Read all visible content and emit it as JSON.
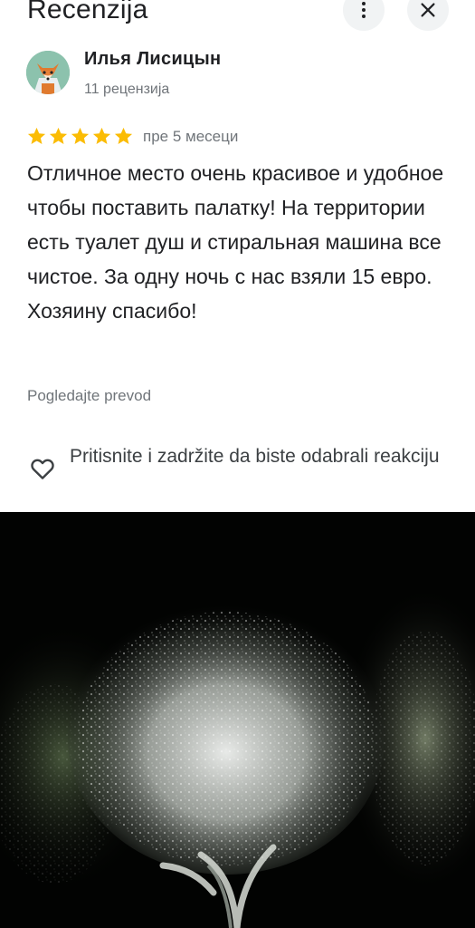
{
  "header": {
    "title": "Recenzija",
    "more_icon": "more-vert-icon",
    "close_icon": "close-icon"
  },
  "reviewer": {
    "name": "Илья Лисицын",
    "meta": "11 рецензија",
    "avatar_icon": "fox-avatar"
  },
  "review": {
    "rating": 5,
    "rating_max": 5,
    "star_color": "#fbbc04",
    "date": "пре 5 месеци",
    "text": "Отличное место очень красивое и удобное чтобы поставить палатку! На территории есть туалет душ и стиральная машина все чистое. За одну ночь с нас взяли 15 евро. Хозяину спасибо!",
    "translate_label": "Pogledajte prevod"
  },
  "reaction": {
    "icon": "heart-outline-icon",
    "label": "Pritisnite i zadržite da biste odabrali reakciju"
  },
  "photo": {
    "subject": "illuminated-olive-tree-at-night"
  }
}
